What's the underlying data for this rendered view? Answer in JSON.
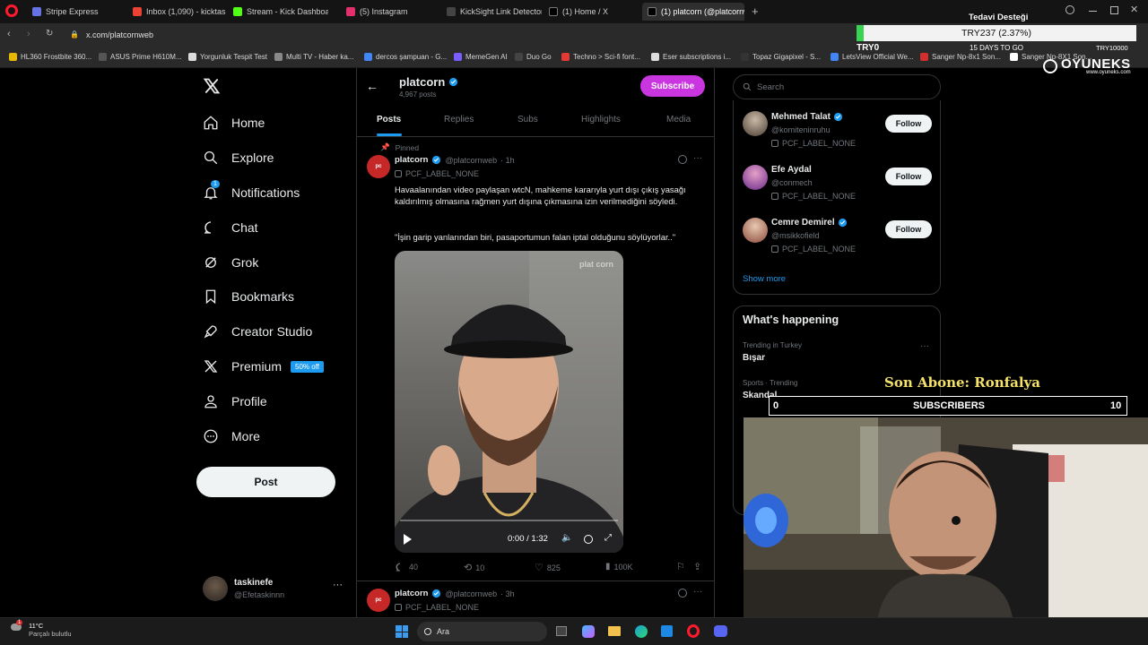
{
  "browser": {
    "tabs": [
      {
        "label": "Stripe Express",
        "color": "#6772e5"
      },
      {
        "label": "Inbox (1,090) - kicktaskine",
        "color": "#ea4335"
      },
      {
        "label": "Stream - Kick Dashboard",
        "color": "#53fc18"
      },
      {
        "label": "(5) Instagram",
        "color": "#e1306c"
      },
      {
        "label": "KickSight Link Detector",
        "color": "#444444"
      },
      {
        "label": "(1) Home / X",
        "color": "#000000"
      },
      {
        "label": "(1) platcorn (@platcornw",
        "color": "#000000"
      }
    ],
    "url": "x.com/platcornweb",
    "bookmarks": [
      "HL360 Frostbite 360...",
      "ASUS Prime H610M...",
      "Yorgunluk Tespit Test",
      "Multi TV - Haber ka...",
      "dercos şampuan - G...",
      "MemeGen AI",
      "Duo Go",
      "Techno > Sci-fi font...",
      "Eser subscriptions i...",
      "Topaz Gigapixel - S...",
      "LetsView Official We...",
      "Sanger Np-8x1 Son...",
      "Sanger Np-8X1 Son..."
    ]
  },
  "sidebar": {
    "items": [
      {
        "label": "Home",
        "icon": "home-icon"
      },
      {
        "label": "Explore",
        "icon": "search-icon"
      },
      {
        "label": "Notifications",
        "icon": "bell-icon",
        "badge": "1"
      },
      {
        "label": "Chat",
        "icon": "chat-icon"
      },
      {
        "label": "Grok",
        "icon": "grok-icon"
      },
      {
        "label": "Bookmarks",
        "icon": "bookmark-icon"
      },
      {
        "label": "Creator Studio",
        "icon": "rocket-icon"
      },
      {
        "label": "Premium",
        "icon": "x-logo-icon",
        "badge": "50% off"
      },
      {
        "label": "Profile",
        "icon": "person-icon"
      },
      {
        "label": "More",
        "icon": "more-circle-icon"
      }
    ],
    "post_label": "Post",
    "account": {
      "name": "taskinefe",
      "handle": "@Efetaskinnn"
    }
  },
  "profile": {
    "name": "platcorn",
    "posts_count": "4,967 posts",
    "subscribe_label": "Subscribe",
    "tabs": [
      "Posts",
      "Replies",
      "Subs",
      "Highlights",
      "Media"
    ]
  },
  "posts": [
    {
      "pinned": "Pinned",
      "name": "platcorn",
      "handle": "@platcornweb",
      "time": "· 1h",
      "label": "PCF_LABEL_NONE",
      "text1": "Havaalanından video paylaşan wtcN, mahkeme kararıyla yurt dışı çıkış yasağı kaldırılmış olmasına rağmen yurt dışına çıkmasına izin verilmediğini söyledi.",
      "text2": "\"İşin garip yanlarından biri, pasaportumun falan iptal olduğunu söylüyorlar..\"",
      "video_time": "0:00 / 1:32",
      "video_progress": 0,
      "watermark": "plat corn",
      "stats": {
        "replies": "40",
        "reposts": "10",
        "likes": "825",
        "views": "100K"
      }
    },
    {
      "name": "platcorn",
      "handle": "@platcornweb",
      "time": "· 3h",
      "label": "PCF_LABEL_NONE"
    }
  ],
  "right": {
    "search_placeholder": "Search",
    "suggestions": [
      {
        "name": "Mehmed Talat",
        "handle": "@komiteninruhu",
        "label": "PCF_LABEL_NONE",
        "follow": "Follow"
      },
      {
        "name": "Efe Aydal",
        "handle": "@conmech",
        "label": "PCF_LABEL_NONE",
        "follow": "Follow"
      },
      {
        "name": "Cemre Demirel",
        "handle": "@msikkofield",
        "label": "PCF_LABEL_NONE",
        "follow": "Follow"
      }
    ],
    "show_more": "Show more",
    "happening_title": "What's happening",
    "trends": [
      {
        "context": "Trending in Turkey",
        "topic": "Bışar"
      },
      {
        "context": "Sports · Trending",
        "topic": "Skandal"
      }
    ]
  },
  "overlays": {
    "donation_title": "Tedavi Desteği",
    "donation_amount": "TRY237 (2.37%)",
    "donation_progress_pct": 2.37,
    "donation_min": "TRY0",
    "donation_days": "15 DAYS TO GO",
    "donation_max": "TRY10000",
    "brand": "OYUNEKS",
    "brand_url": "www.oyuneks.com",
    "last_sub": "Son Abone: Ronfalya",
    "subs_label": "SUBSCRIBERS",
    "subs_min": "0",
    "subs_max": "10"
  },
  "taskbar": {
    "weather_temp": "11°C",
    "weather_desc": "Parçalı bulutlu",
    "weather_badge": "1",
    "search": "Ara"
  },
  "colors": {
    "accent": "#1d9bf0",
    "subscribe": "#c936e0",
    "background": "#000000"
  }
}
